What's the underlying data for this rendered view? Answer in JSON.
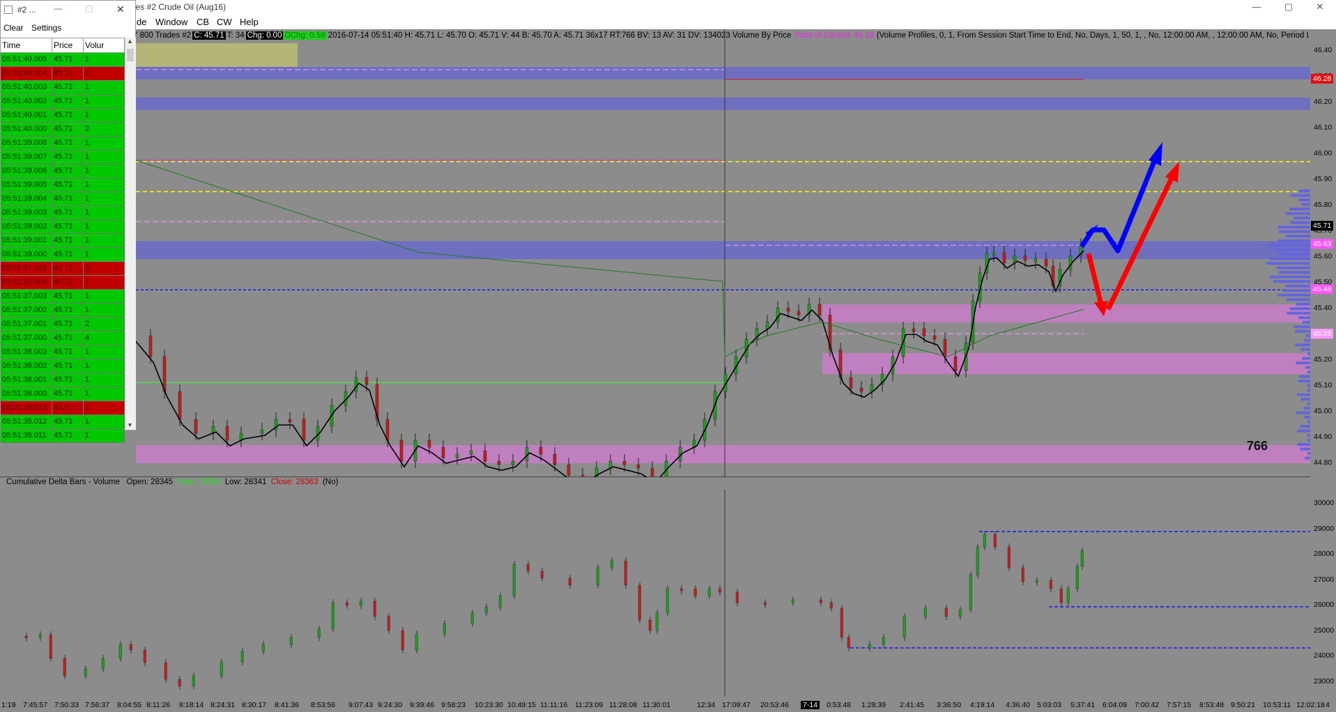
{
  "app": {
    "title": "Crude Oil (Aug16)",
    "chart_title_prefix": "des  #2  Crude Oil (Aug16)",
    "min_glyph": "—",
    "max_glyph": "▢",
    "close_glyph": "✕"
  },
  "menu": [
    {
      "label": "de"
    },
    {
      "label": "Window"
    },
    {
      "label": "CB"
    },
    {
      "label": "CW"
    },
    {
      "label": "Help"
    }
  ],
  "info_line": {
    "prefix": "Y  800 Trades  #2",
    "last": "C: 45.71",
    "text1": "T: 34",
    "chg": "Chg: 0.00",
    "dchg": "DChg: 0.58",
    "text2": "2016-07-14 05:51:40  H: 45.71  L: 45.70  O: 45.71  V: 44  B: 45.70  A: 45.71  36x17  RT:766  BV: 13  AV: 31  DV: 134023  Volume By Price",
    "poc": "Point of Control: 45.18",
    "text3": "(Volume Profiles, 0, 1, From Session Start Time to End, No, Days, 1, 50, 1, , No, 12:00:00 AM, , 12:00:00 AM, No, Period Len"
  },
  "price_axis": [
    "46.40",
    "46.30",
    "46.20",
    "46.10",
    "46.00",
    "45.90",
    "45.80",
    "45.70",
    "45.60",
    "45.50",
    "45.40",
    "45.30",
    "45.20",
    "45.10",
    "45.00",
    "44.90",
    "44.80"
  ],
  "price_tags": [
    {
      "text": "46.28",
      "bg": "#e01010",
      "fg": "#ffffff"
    },
    {
      "text": "45.71",
      "bg": "#000000",
      "fg": "#ffffff"
    },
    {
      "text": "45.63",
      "bg": "#ff55ff",
      "fg": "#ffffff"
    },
    {
      "text": "45.46",
      "bg": "#ff55ff",
      "fg": "#ffffff"
    },
    {
      "text": "45.28",
      "bg": "#ff99ff",
      "fg": "#ffffff"
    }
  ],
  "bars_count": "766",
  "delta_panel": {
    "name": "Cumulative Delta Bars - Volume",
    "open": "Open: 28345",
    "high": "High: 28363",
    "low": "Low: 28341",
    "close": "Close: 28363",
    "suffix": "(No)",
    "axis": [
      "30000",
      "29000",
      "28000",
      "27000",
      "26000",
      "25000",
      "24000",
      "23000"
    ]
  },
  "time_axis": [
    "1:19",
    "7:45:57",
    "7:50:33",
    "7:56:37",
    "8:04:55",
    "8:11:26",
    "8:18:14",
    "8:24:31",
    "8:30:17",
    "8:41:36",
    "8:53:56",
    "9:07:43",
    "9:24:30",
    "9:39:46",
    "9:58:23",
    "10:23:30",
    "10:49:15",
    "11:11:16",
    "11:23:09",
    "11:28:08",
    "11:30:01",
    "12:34",
    "17:09:47",
    "20:53:46",
    "7-14",
    "0:53:48",
    "1:28:39",
    "2:41:45",
    "3:36:50",
    "4:19:14",
    "4:36:40",
    "5:03:03",
    "5:37:41",
    "6:04:09",
    "7:00:42",
    "7:57:15",
    "8:53:48",
    "9:50:21",
    "10:53:11",
    "12:02:18",
    "4"
  ],
  "ts": {
    "title": "#2 ...",
    "toolbar": [
      "Clear",
      "Settings"
    ],
    "headers": [
      "Time",
      "Price",
      "Volur"
    ],
    "rows": [
      {
        "time": "05:51:40.005",
        "price": "45.71",
        "vol": "1",
        "side": "buy"
      },
      {
        "time": "05:51:40.004",
        "price": "45.71",
        "vol": "2",
        "side": "sell"
      },
      {
        "time": "05:51:40.003",
        "price": "45.71",
        "vol": "1",
        "side": "buy"
      },
      {
        "time": "05:51:40.002",
        "price": "45.71",
        "vol": "1",
        "side": "buy"
      },
      {
        "time": "05:51:40.001",
        "price": "45.71",
        "vol": "1",
        "side": "buy"
      },
      {
        "time": "05:51:40.000",
        "price": "45.71",
        "vol": "2",
        "side": "buy"
      },
      {
        "time": "05:51:39.008",
        "price": "45.71",
        "vol": "1",
        "side": "buy"
      },
      {
        "time": "05:51:39.007",
        "price": "45.71",
        "vol": "1",
        "side": "buy"
      },
      {
        "time": "05:51:39.006",
        "price": "45.71",
        "vol": "1",
        "side": "buy"
      },
      {
        "time": "05:51:39.005",
        "price": "45.71",
        "vol": "1",
        "side": "buy"
      },
      {
        "time": "05:51:39.004",
        "price": "45.71",
        "vol": "1",
        "side": "buy"
      },
      {
        "time": "05:51:39.003",
        "price": "45.71",
        "vol": "1",
        "side": "buy"
      },
      {
        "time": "05:51:39.002",
        "price": "45.71",
        "vol": "1",
        "side": "buy"
      },
      {
        "time": "05:51:39.001",
        "price": "45.71",
        "vol": "1",
        "side": "buy"
      },
      {
        "time": "05:51:39.000",
        "price": "45.71",
        "vol": "1",
        "side": "buy"
      },
      {
        "time": "05:51:37.005",
        "price": "45.71",
        "vol": "5",
        "side": "sell"
      },
      {
        "time": "05:51:37.004",
        "price": "45.71",
        "vol": "1",
        "side": "sell"
      },
      {
        "time": "05:51:37.003",
        "price": "45.71",
        "vol": "1",
        "side": "buy"
      },
      {
        "time": "05:51:37.002",
        "price": "45.71",
        "vol": "1",
        "side": "buy"
      },
      {
        "time": "05:51:37.001",
        "price": "45.71",
        "vol": "2",
        "side": "buy"
      },
      {
        "time": "05:51:37.000",
        "price": "45.71",
        "vol": "4",
        "side": "buy"
      },
      {
        "time": "05:51:36.003",
        "price": "45.71",
        "vol": "1",
        "side": "buy"
      },
      {
        "time": "05:51:36.002",
        "price": "45.71",
        "vol": "1",
        "side": "buy"
      },
      {
        "time": "05:51:36.001",
        "price": "45.71",
        "vol": "1",
        "side": "buy"
      },
      {
        "time": "05:51:36.000",
        "price": "45.71",
        "vol": "1",
        "side": "buy"
      },
      {
        "time": "05:51:35.013",
        "price": "45.70",
        "vol": "1",
        "side": "sell"
      },
      {
        "time": "05:51:35.012",
        "price": "45.71",
        "vol": "1",
        "side": "buy"
      },
      {
        "time": "05:51:35.011",
        "price": "45.71",
        "vol": "1",
        "side": "buy"
      }
    ]
  },
  "colors": {
    "bg": "#8c8c8c",
    "zone_blue": "#6f6fc0",
    "zone_pink": "#c080c0",
    "up": "#20a020",
    "down": "#c02020",
    "arrow_blue": "#0000ff",
    "arrow_red": "#ff0000"
  }
}
